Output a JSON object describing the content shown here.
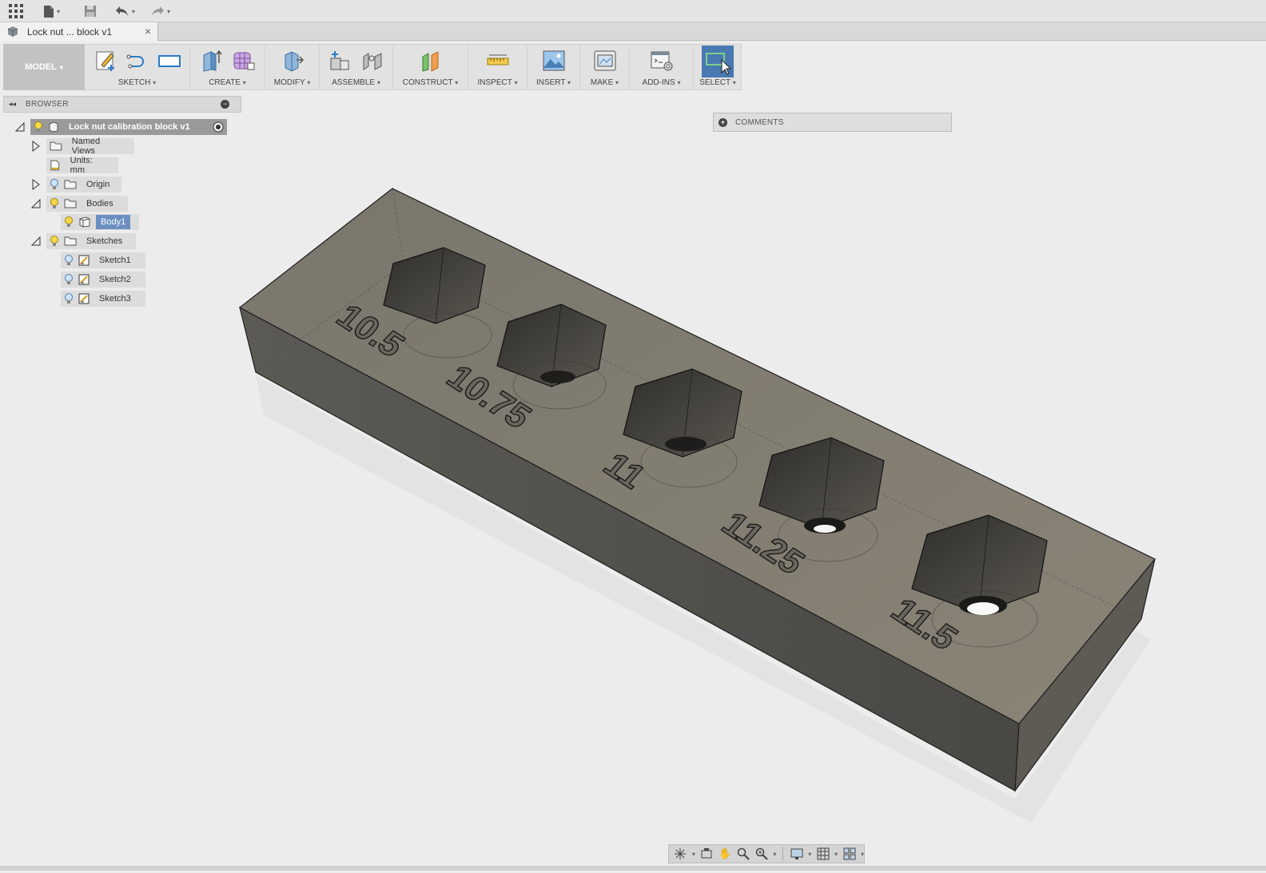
{
  "topbar": {
    "icons": [
      "apps-grid-icon",
      "file-icon",
      "save-icon",
      "undo-icon",
      "redo-icon"
    ]
  },
  "document_tab": {
    "title": "Lock nut ... block v1",
    "close": "×"
  },
  "toolbar": {
    "workspace": "MODEL",
    "groups": {
      "sketch": "SKETCH",
      "create": "CREATE",
      "modify": "MODIFY",
      "assemble": "ASSEMBLE",
      "construct": "CONSTRUCT",
      "inspect": "INSPECT",
      "insert": "INSERT",
      "make": "MAKE",
      "addins": "ADD-INS",
      "select": "SELECT"
    },
    "caret": "▾"
  },
  "browser": {
    "title": "BROWSER",
    "root": "Lock nut calibration block v1",
    "named_views": "Named Views",
    "units": "Units: mm",
    "origin": "Origin",
    "bodies": "Bodies",
    "body1": "Body1",
    "sketches": "Sketches",
    "sketch1": "Sketch1",
    "sketch2": "Sketch2",
    "sketch3": "Sketch3"
  },
  "comments": {
    "label": "COMMENTS"
  },
  "model": {
    "labels": [
      "10.5",
      "10.75",
      "11",
      "11.25",
      "11.5"
    ],
    "body_color": "#7c776b",
    "edge_color": "#2a2a2a"
  },
  "navbar": {
    "icons": [
      "orbit-icon",
      "look-at-icon",
      "pan-icon",
      "zoom-icon",
      "fit-icon",
      "display-settings-icon",
      "grid-icon",
      "viewports-icon"
    ]
  }
}
